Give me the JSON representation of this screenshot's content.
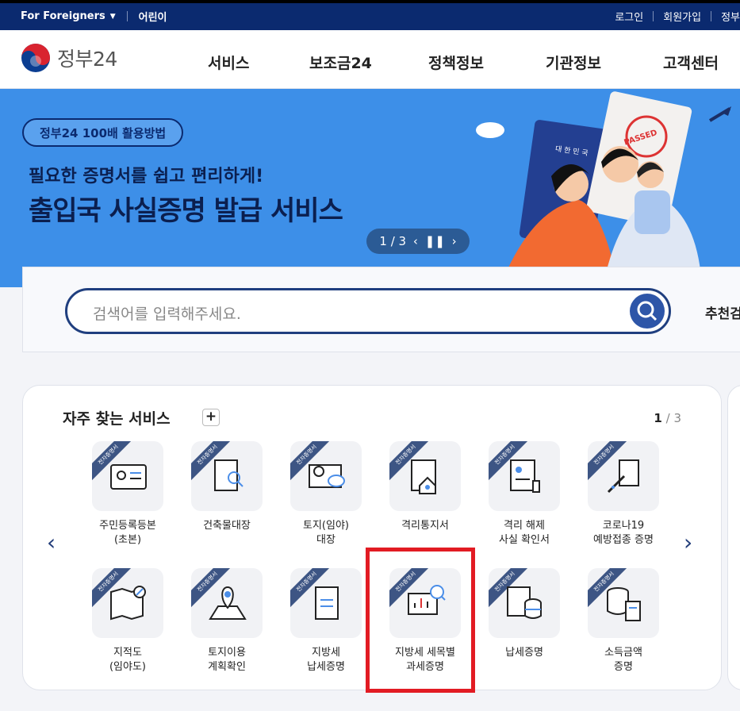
{
  "topbar": {
    "foreigners": "For Foreigners",
    "kids": "어린이",
    "login": "로그인",
    "signup": "회원가입",
    "more": "정부"
  },
  "header": {
    "logo_text": "정부24",
    "nav": [
      "서비스",
      "보조금24",
      "정책정보",
      "기관정보",
      "고객센터"
    ]
  },
  "banner": {
    "pill": "정부24 100배 활용방법",
    "subtitle": "필요한 증명서를 쉽고 편리하게!",
    "title": "출입국 사실증명 발급 서비스",
    "pager": "1 / 3",
    "passport_text": "대 한 민 국",
    "stamp_text": "PASSED"
  },
  "search": {
    "placeholder": "검색어를 입력해주세요.",
    "recommended": "추천검"
  },
  "services": {
    "title": "자주 찾는 서비스",
    "plus": "+",
    "page_current": "1",
    "page_sep": "/",
    "page_total": "3",
    "ribbon": "전자증명서",
    "items": [
      {
        "label1": "주민등록등본",
        "label2": "(초본)",
        "icon": "id-card-icon"
      },
      {
        "label1": "건축물대장",
        "label2": "",
        "icon": "document-search-icon"
      },
      {
        "label1": "토지(임야)",
        "label2": "대장",
        "icon": "land-map-icon"
      },
      {
        "label1": "격리통지서",
        "label2": "",
        "icon": "quarantine-notice-icon"
      },
      {
        "label1": "격리 해제",
        "label2": "사실 확인서",
        "icon": "quarantine-release-icon"
      },
      {
        "label1": "코로나19",
        "label2": "예방접종 증명",
        "icon": "vaccine-certificate-icon"
      },
      {
        "label1": "지적도",
        "label2": "(임야도)",
        "icon": "cadastral-map-icon"
      },
      {
        "label1": "토지이용",
        "label2": "계획확인",
        "icon": "land-use-plan-icon"
      },
      {
        "label1": "지방세",
        "label2": "납세증명",
        "icon": "local-tax-icon"
      },
      {
        "label1": "지방세 세목별",
        "label2": "과세증명",
        "icon": "tax-chart-icon"
      },
      {
        "label1": "납세증명",
        "label2": "",
        "icon": "tax-payment-icon"
      },
      {
        "label1": "소득금액",
        "label2": "증명",
        "icon": "income-certificate-icon"
      }
    ]
  }
}
